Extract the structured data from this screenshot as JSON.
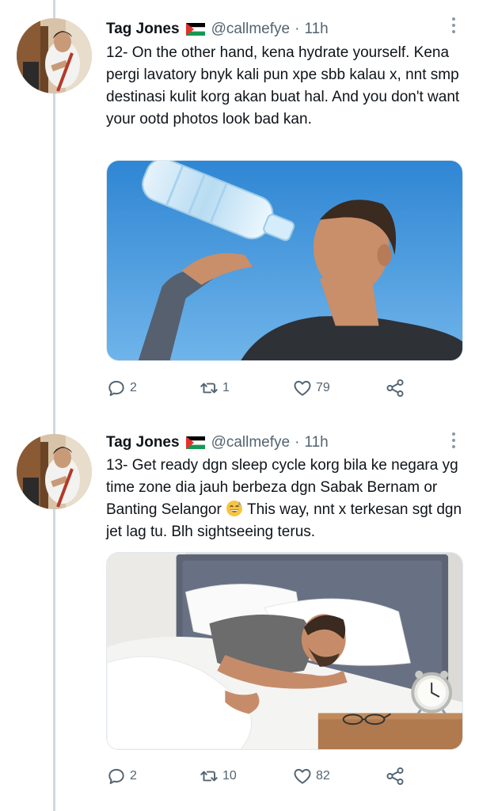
{
  "tweets": [
    {
      "author_name": "Tag Jones",
      "handle": "@callmefye",
      "separator": "·",
      "time": "11h",
      "text": "12- On the other hand, kena hydrate yourself. Kena pergi lavatory bnyk kali pun xpe sbb kalau x, nnt smp destinasi kulit korg akan buat hal. And you don't want your ootd photos look bad kan.",
      "text_after_emoji": "",
      "replies": "2",
      "retweets": "1",
      "likes": "79"
    },
    {
      "author_name": "Tag Jones",
      "handle": "@callmefye",
      "separator": "·",
      "time": "11h",
      "text": "13- Get ready dgn sleep cycle korg bila ke negara yg time zone dia jauh berbeza dgn Sabak Bernam or Banting Selangor",
      "text_after_emoji": " This way, nnt x terkesan sgt dgn jet lag tu. Blh sightseeing terus.",
      "replies": "2",
      "retweets": "10",
      "likes": "82"
    }
  ],
  "icons": {
    "reply": "reply-icon",
    "retweet": "retweet-icon",
    "like": "heart-icon",
    "share": "share-icon",
    "more": "more-vertical-icon",
    "flag": "palestine-flag-icon",
    "emoji": "grinning-sweat-emoji"
  },
  "colors": {
    "text": "#0f1419",
    "muted": "#536471",
    "thread_line": "#cfd9de",
    "sky": "#3a8fd6"
  }
}
